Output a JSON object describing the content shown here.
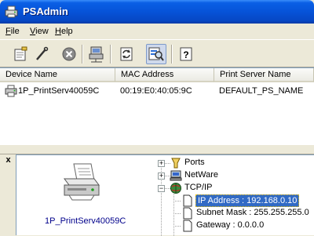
{
  "window": {
    "title": "PSAdmin"
  },
  "menu": [
    {
      "label_u": "F",
      "label_rest": "ile"
    },
    {
      "label_u": "V",
      "label_rest": "iew"
    },
    {
      "label_u": "H",
      "label_rest": "elp"
    }
  ],
  "toolbar": {
    "icons": [
      "properties-icon",
      "wrench-icon",
      "stop-icon",
      "printer-network-icon",
      "refresh-icon",
      "search-network-icon",
      "help-icon"
    ],
    "active_index": 5
  },
  "list": {
    "columns": [
      "Device Name",
      "MAC Address",
      "Print Server Name"
    ],
    "rows": [
      {
        "device_name": "1P_PrintServ40059C",
        "mac": "00:19:E0:40:05:9C",
        "server_name": "DEFAULT_PS_NAME"
      }
    ]
  },
  "detail": {
    "close_label": "x",
    "device_caption": "1P_PrintServ40059C",
    "tree": {
      "ports": "Ports",
      "netware": "NetWare",
      "tcpip": "TCP/IP",
      "ip": "IP Address : 192.168.0.10",
      "subnet": "Subnet Mask : 255.255.255.0",
      "gateway": "Gateway : 0.0.0.0"
    }
  },
  "colors": {
    "selection": "#316ac5",
    "titlebar": "#0653d8",
    "link_text": "#00008b"
  }
}
